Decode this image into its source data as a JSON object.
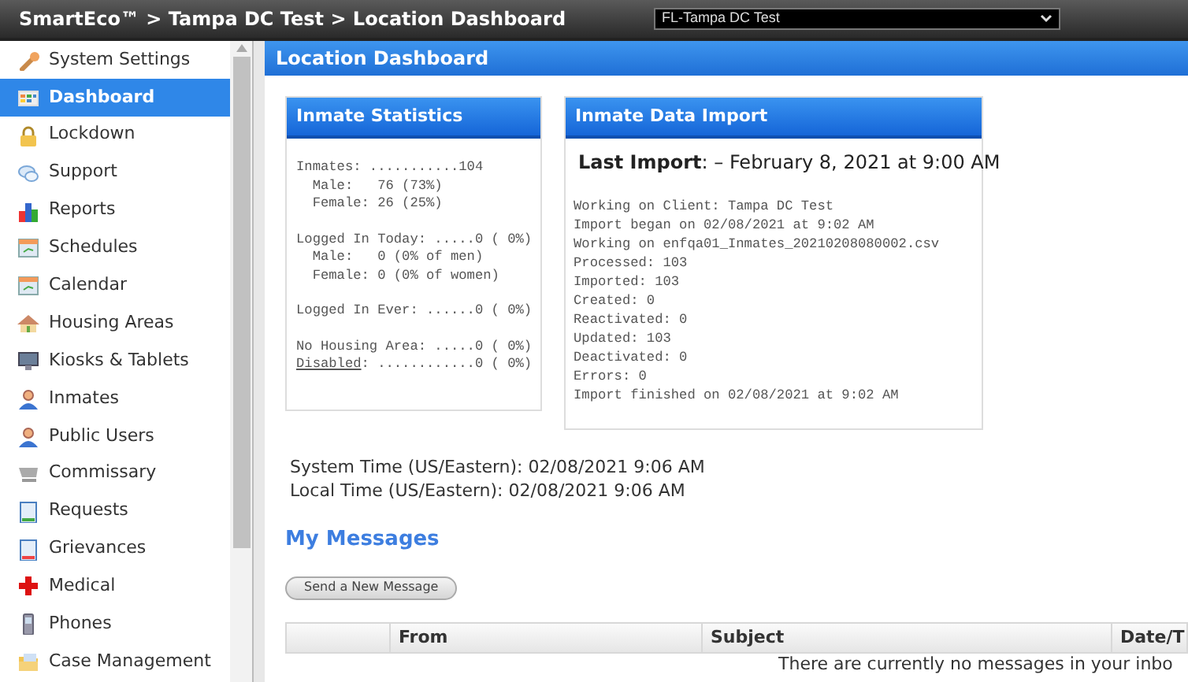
{
  "title_bar": {
    "breadcrumb": "SmartEco™ > Tampa DC Test > Location Dashboard",
    "location_select": "FL-Tampa DC Test"
  },
  "sidebar": {
    "items": [
      {
        "label": "System Settings",
        "selected": false
      },
      {
        "label": "Dashboard",
        "selected": true
      },
      {
        "label": "Lockdown",
        "selected": false
      },
      {
        "label": "Support",
        "selected": false
      },
      {
        "label": "Reports",
        "selected": false
      },
      {
        "label": "Schedules",
        "selected": false
      },
      {
        "label": "Calendar",
        "selected": false
      },
      {
        "label": "Housing Areas",
        "selected": false
      },
      {
        "label": "Kiosks & Tablets",
        "selected": false
      },
      {
        "label": "Inmates",
        "selected": false
      },
      {
        "label": "Public Users",
        "selected": false
      },
      {
        "label": "Commissary",
        "selected": false
      },
      {
        "label": "Requests",
        "selected": false
      },
      {
        "label": "Grievances",
        "selected": false
      },
      {
        "label": "Medical",
        "selected": false
      },
      {
        "label": "Phones",
        "selected": false
      },
      {
        "label": "Case Management",
        "selected": false
      }
    ]
  },
  "page_header": "Location Dashboard",
  "inmate_statistics": {
    "title": "Inmate Statistics",
    "groups": [
      [
        "Inmates: ...........104",
        "  Male:   76 (73%)",
        "  Female: 26 (25%)"
      ],
      [
        "Logged In Today: .....0 ( 0%)",
        "  Male:   0 (0% of men)",
        "  Female: 0 (0% of women)"
      ],
      [
        "Logged In Ever: ......0 ( 0%)"
      ],
      [
        "No Housing Area: .....0 ( 0%)"
      ]
    ],
    "link_line": {
      "link": "Disabled",
      "text": ": ............0 ( 0%)"
    }
  },
  "inmate_data_import": {
    "title": "Inmate Data Import",
    "last_import": "**Last Import**: – February 8, 2021 at 9:00 AM",
    "log": [
      "Working on Client: Tampa DC Test",
      "Import began on 02/08/2021 at 9:02 AM",
      "Working on enfqa01_Inmates_20210208080002.csv",
      "Processed: 103",
      "Imported: 103",
      "Created: 0",
      "Reactivated: 0",
      "Updated: 103",
      "Deactivated: 0",
      "Errors: 0",
      "Import finished on 02/08/2021 at 9:02 AM"
    ]
  },
  "times": [
    "System Time (US/Eastern): 02/08/2021 9:06 AM",
    "Local Time (US/Eastern): 02/08/2021 9:06 AM"
  ],
  "messages": {
    "title": "My Messages",
    "button": "Send a New Message",
    "columns": [
      "From",
      "Subject",
      "Date/T"
    ],
    "empty_text": "There are currently no messages in your inbo"
  }
}
